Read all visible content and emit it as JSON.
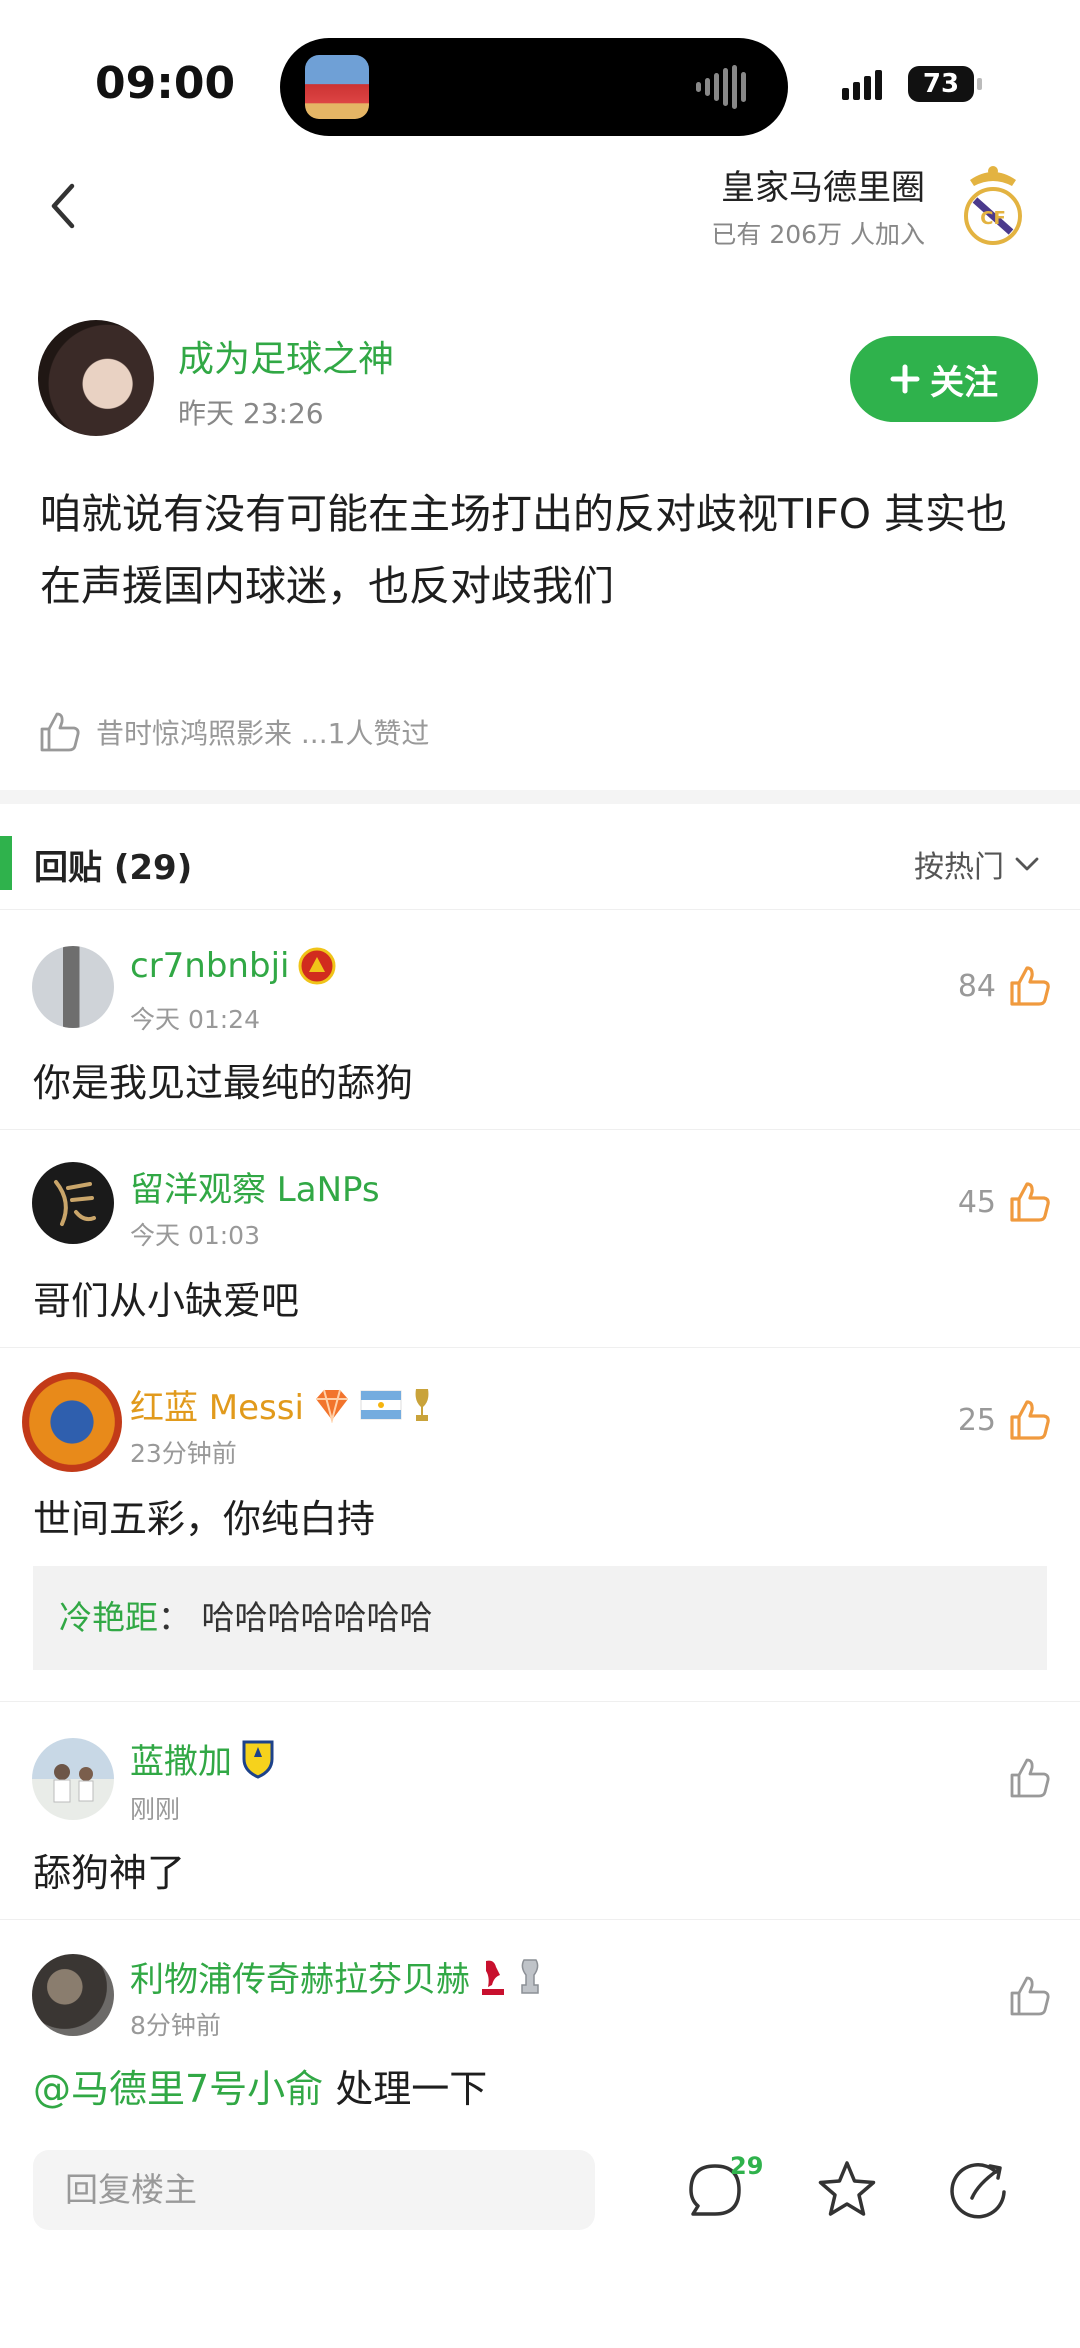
{
  "status_bar": {
    "time": "09:00",
    "battery": "73"
  },
  "circle": {
    "name": "皇家马德里圈",
    "members": "已有 206万 人加入"
  },
  "post": {
    "author": "成为足球之神",
    "time": "昨天 23:26",
    "follow_label": "关注",
    "body": "咱就说有没有可能在主场打出的反对歧视TIFO 其实也在声援国内球迷，也反对歧我们",
    "likes_text": "昔时惊鸿照影来 ...1人赞过"
  },
  "replies": {
    "title": "回贴 (29)",
    "sort_label": "按热门",
    "items": [
      {
        "user": "cr7nbnbji",
        "time": "今天 01:24",
        "likes": "84",
        "text": "你是我见过最纯的舔狗"
      },
      {
        "user": "留洋观察 LaNPs",
        "time": "今天 01:03",
        "likes": "45",
        "text": "哥们从小缺爱吧"
      },
      {
        "user": "红蓝 Messi",
        "time": "23分钟前",
        "likes": "25",
        "text": "世间五彩，你纯白持",
        "sub_reply": {
          "user": "冷艳距",
          "sep": "：",
          "text": "哈哈哈哈哈哈哈"
        }
      },
      {
        "user": "蓝撒加",
        "time": "刚刚",
        "likes": "",
        "text": "舔狗神了"
      },
      {
        "user": "利物浦传奇赫拉芬贝赫",
        "time": "8分钟前",
        "likes": "",
        "mention": "@马德里7号小俞",
        "text": "处理一下"
      }
    ]
  },
  "bottom_bar": {
    "reply_placeholder": "回复楼主",
    "comment_count": "29"
  },
  "colors": {
    "accent_green": "#2fb24c",
    "name_green": "#31a845",
    "like_orange": "#f09a3e",
    "vip_gold": "#e19a1c"
  }
}
